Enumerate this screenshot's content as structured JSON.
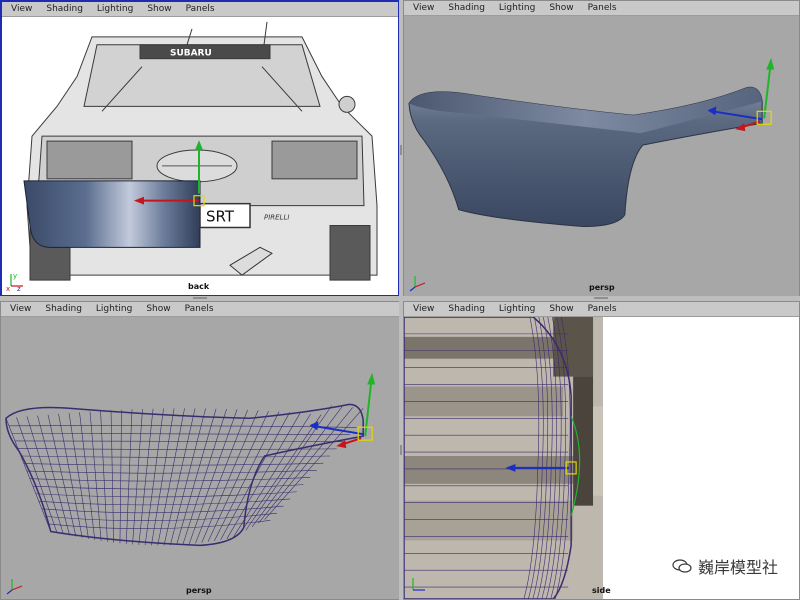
{
  "menu": [
    "View",
    "Shading",
    "Lighting",
    "Show",
    "Panels"
  ],
  "viewports": {
    "back": {
      "camera": "back",
      "badge_brand": "SUBARU",
      "plate": "SRT",
      "sponsor": "PIRELLI"
    },
    "persp_shaded": {
      "camera": "persp"
    },
    "persp_wire": {
      "camera": "persp"
    },
    "side": {
      "camera": "side"
    }
  },
  "axis_labels": {
    "x": "x",
    "y": "y",
    "z": "z"
  },
  "watermark": "巍岸模型社",
  "colors": {
    "active_border": "#1d2bb5",
    "viewport_bg": "#a7a7a7",
    "mesh_shaded": "#4d5b73",
    "wireframe": "#3a2c6e",
    "manip_y": "#1fb52a",
    "manip_x": "#c4161c",
    "manip_z": "#1a2ec4",
    "manip_box": "#e6d800"
  }
}
